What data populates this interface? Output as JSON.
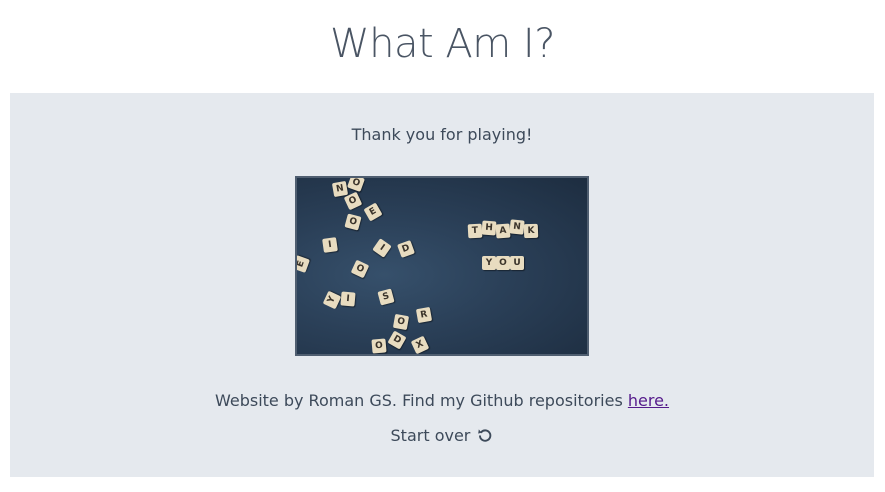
{
  "header": {
    "title": "What Am I?"
  },
  "end_screen": {
    "message": "Thank you for playing!",
    "image_alt": "Scrabble tiles spelling THANK YOU",
    "tiles": [
      {
        "ch": "N"
      },
      {
        "ch": "O"
      },
      {
        "ch": "O"
      },
      {
        "ch": "O"
      },
      {
        "ch": "E"
      },
      {
        "ch": "I"
      },
      {
        "ch": "I"
      },
      {
        "ch": "D"
      },
      {
        "ch": "E"
      },
      {
        "ch": "O"
      },
      {
        "ch": "Y"
      },
      {
        "ch": "I"
      },
      {
        "ch": "S"
      },
      {
        "ch": "O"
      },
      {
        "ch": "R"
      },
      {
        "ch": "D"
      },
      {
        "ch": "O"
      },
      {
        "ch": "X"
      },
      {
        "ch": "T"
      },
      {
        "ch": "H"
      },
      {
        "ch": "A"
      },
      {
        "ch": "N"
      },
      {
        "ch": "K"
      },
      {
        "ch": "Y"
      },
      {
        "ch": "O"
      },
      {
        "ch": "U"
      }
    ]
  },
  "footer": {
    "credit_text": "Website by Roman GS. Find my Github repositories ",
    "link_label": "here.",
    "start_over_label": "Start over"
  },
  "icons": {
    "restart": "restart-icon"
  }
}
